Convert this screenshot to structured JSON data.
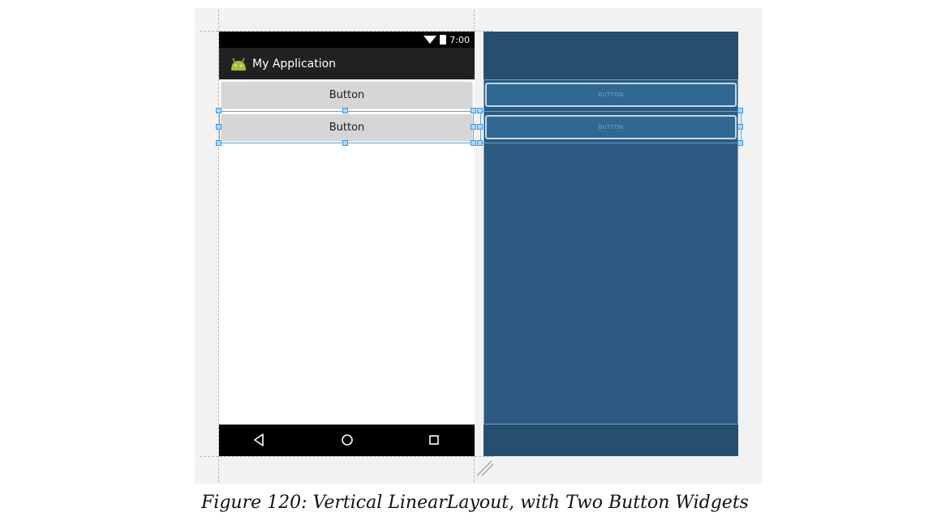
{
  "status_bar": {
    "time": "7:00",
    "icons": [
      "wifi-icon",
      "battery-icon"
    ]
  },
  "app_bar": {
    "title": "My Application",
    "icon": "android-icon",
    "color": "#212121"
  },
  "buttons": [
    {
      "label": "Button"
    },
    {
      "label": "Button"
    }
  ],
  "blueprint": {
    "buttons": [
      {
        "label": "BUTTON"
      },
      {
        "label": "BUTTON"
      }
    ],
    "color": "#264e6f"
  },
  "nav_bar": {
    "icons": [
      "back-icon",
      "home-icon",
      "recents-icon"
    ]
  },
  "selection_color": "#55a7e6",
  "caption": "Figure 120: Vertical LinearLayout, with Two Button Widgets"
}
